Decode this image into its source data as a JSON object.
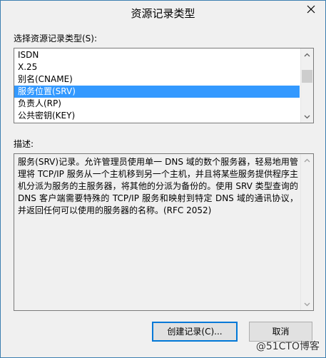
{
  "window": {
    "title": "资源记录类型"
  },
  "list_label": "选择资源记录类型(S):",
  "record_types": [
    {
      "label": "ISDN",
      "selected": false
    },
    {
      "label": "X.25",
      "selected": false
    },
    {
      "label": "别名(CNAME)",
      "selected": false
    },
    {
      "label": "服务位置(SRV)",
      "selected": true
    },
    {
      "label": "负责人(RP)",
      "selected": false
    },
    {
      "label": "公共密钥(KEY)",
      "selected": false
    }
  ],
  "description_label": "描述:",
  "description": "服务(SRV)记录。允许管理员使用单一 DNS 域的数个服务器，轻易地用管理将 TCP/IP 服务从一个主机移到另一个主机，并且将某些服务提供程序主机分派为服务的主服务器，将其他的分派为备份的。使用 SRV 类型查询的 DNS 客户端需要特殊的 TCP/IP 服务和映射到特定 DNS 域的通讯协议，并返回任何可以使用的服务器的名称。(RFC 2052)",
  "buttons": {
    "create": "创建记录(C)...",
    "cancel": "取消"
  },
  "watermark": "@51CTO博客"
}
